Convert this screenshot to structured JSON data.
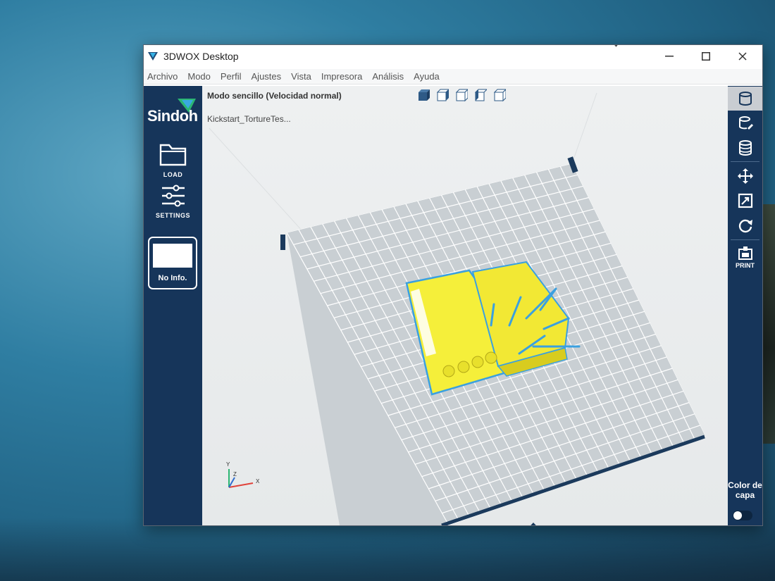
{
  "window": {
    "title": "3DWOX Desktop"
  },
  "menu": [
    "Archivo",
    "Modo",
    "Perfil",
    "Ajustes",
    "Vista",
    "Impresora",
    "Análisis",
    "Ayuda"
  ],
  "sidebar_left": {
    "brand": "Sindoh",
    "load_label": "LOAD",
    "settings_label": "SETTINGS",
    "info_label": "No Info."
  },
  "viewport": {
    "mode_label": "Modo sencillo (Velocidad normal)",
    "file_label": "Kickstart_TortureTes...",
    "axis_labels": {
      "x": "X",
      "y": "Y",
      "z": "Z"
    },
    "model_color": "#f5ef3a"
  },
  "sidebar_right": {
    "print_label": "PRINT",
    "color_de_capa_label": "Color de capa"
  },
  "icons": [
    "cube-view-icons",
    "load-folder-icon",
    "settings-sliders-icon",
    "cylinder-icon",
    "cylinder-edit-icon",
    "layers-icon",
    "move-icon",
    "scale-icon",
    "rotate-icon",
    "print-icon"
  ],
  "colors": {
    "sidebar": "#16355a",
    "accent": "#3aa0e0",
    "grid_line": "#ffffff",
    "bed": "#c9cfd3"
  }
}
